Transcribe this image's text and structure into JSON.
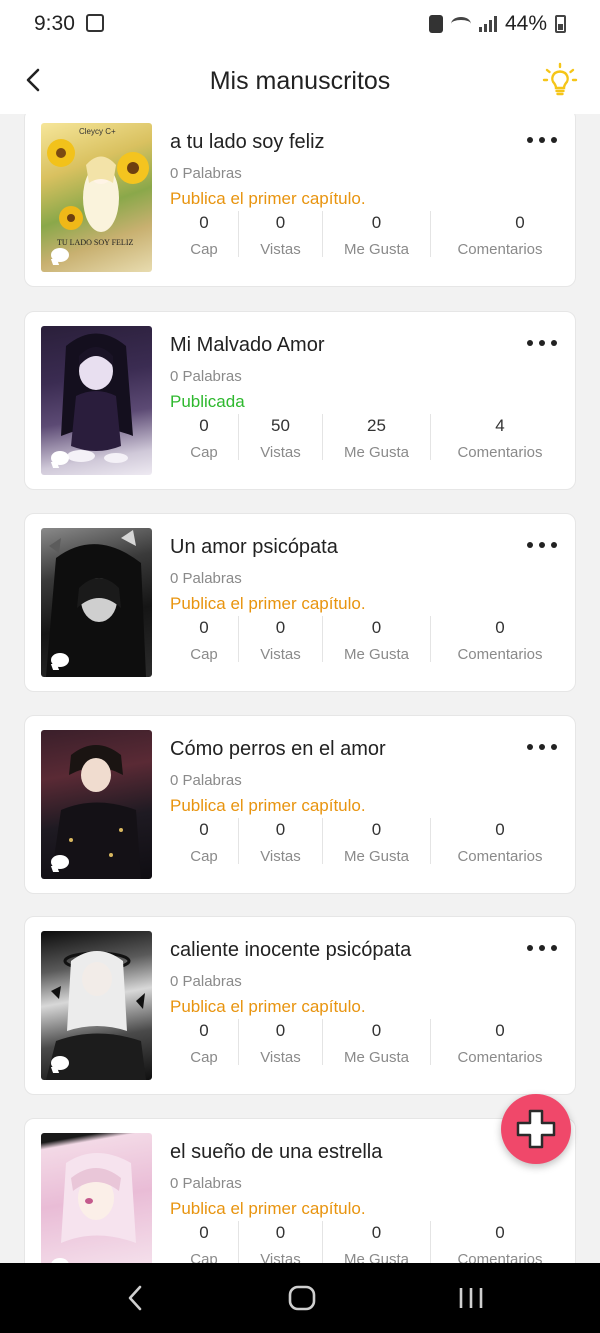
{
  "status_bar": {
    "time": "9:30",
    "battery": "44%"
  },
  "header": {
    "title": "Mis manuscritos"
  },
  "stat_labels": {
    "cap": "Cap",
    "vistas": "Vistas",
    "megusta": "Me Gusta",
    "comentarios": "Comentarios"
  },
  "books": [
    {
      "title": "a tu lado soy feliz",
      "words": "0 Palabras",
      "status": "Publica el primer capítulo.",
      "cap": "0",
      "vistas": "0",
      "megusta": "0",
      "comentarios": "0",
      "cover_text_top": "Cleycy C+",
      "cover_text_bottom": "TU LADO SOY FELIZ"
    },
    {
      "title": "Mi Malvado Amor",
      "words": "0 Palabras",
      "status": "Publicada",
      "cap": "0",
      "vistas": "50",
      "megusta": "25",
      "comentarios": "4"
    },
    {
      "title": "Un amor psicópata",
      "words": "0 Palabras",
      "status": "Publica el primer capítulo.",
      "cap": "0",
      "vistas": "0",
      "megusta": "0",
      "comentarios": "0"
    },
    {
      "title": "Cómo perros en el amor",
      "words": "0 Palabras",
      "status": "Publica el primer capítulo.",
      "cap": "0",
      "vistas": "0",
      "megusta": "0",
      "comentarios": "0"
    },
    {
      "title": "caliente inocente psicópata",
      "words": "0 Palabras",
      "status": "Publica el primer capítulo.",
      "cap": "0",
      "vistas": "0",
      "megusta": "0",
      "comentarios": "0"
    },
    {
      "title": "el sueño de una estrella",
      "words": "0 Palabras",
      "status": "Publica el primer capítulo.",
      "cap": "0",
      "vistas": "0",
      "megusta": "0",
      "comentarios": "0"
    }
  ],
  "colors": {
    "pending": "#e8940f",
    "published": "#2eb82e",
    "fab": "#f0486a",
    "bulb": "#f5c518"
  }
}
